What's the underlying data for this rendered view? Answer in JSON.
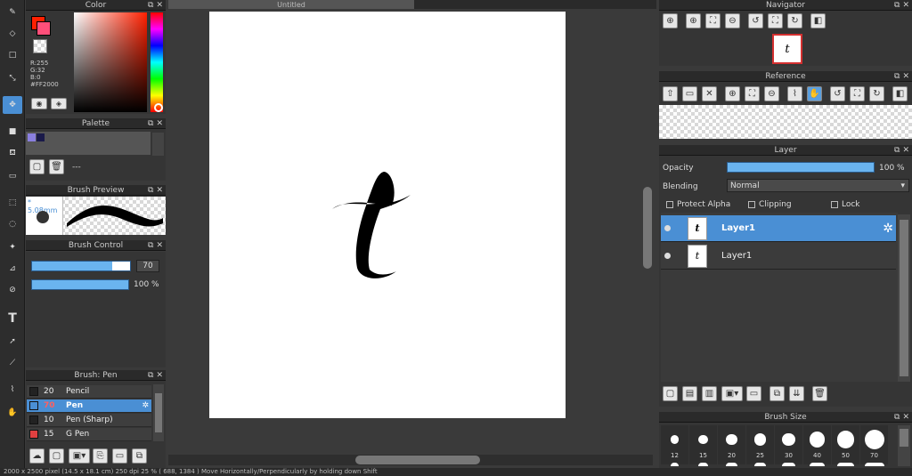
{
  "color": {
    "title": "Color",
    "r": "R:255",
    "g": "G:32",
    "b": "B:0",
    "hex": "#FF2000",
    "fg": "#FF2000",
    "bg": "#ff4f7a"
  },
  "palette": {
    "title": "Palette",
    "label": "---",
    "swatches": [
      "#8a7fe0",
      "#1a1a4a"
    ]
  },
  "brush_preview": {
    "title": "Brush Preview",
    "size": "5.08mm"
  },
  "brush_control": {
    "title": "Brush Control",
    "size_value": "70",
    "size_fraction": 0.82,
    "opacity_value": "100 %",
    "opacity_fraction": 1.0
  },
  "brush_list": {
    "title": "Brush: Pen",
    "items": [
      {
        "size": "20",
        "name": "Pencil",
        "color": "#222222",
        "selected": false
      },
      {
        "size": "70",
        "name": "Pen",
        "color": "#4a8fd4",
        "selected": true
      },
      {
        "size": "10",
        "name": "Pen (Sharp)",
        "color": "#222222",
        "selected": false
      },
      {
        "size": "15",
        "name": "G Pen",
        "color": "#e04040",
        "selected": false
      }
    ]
  },
  "canvas": {
    "tab_title": "Untitled",
    "glyph": "t"
  },
  "navigator": {
    "title": "Navigator",
    "thumb_glyph": "t"
  },
  "reference": {
    "title": "Reference"
  },
  "layer": {
    "title": "Layer",
    "opacity_label": "Opacity",
    "opacity_value": "100 %",
    "opacity_fraction": 1.0,
    "blending_label": "Blending",
    "blending_value": "Normal",
    "protect_alpha": "Protect Alpha",
    "clipping": "Clipping",
    "lock": "Lock",
    "layers": [
      {
        "name": "Layer1",
        "selected": true
      },
      {
        "name": "Layer1",
        "selected": false
      }
    ]
  },
  "brush_size": {
    "title": "Brush Size",
    "sizes": [
      "12",
      "15",
      "20",
      "25",
      "30",
      "40",
      "50",
      "70"
    ]
  },
  "status": {
    "text": "2000 x 2500 pixel   (14.5 x 18.1 cm)   250 dpi   25 %   ( 688, 1384 )   Move Horizontally/Perpendicularly by holding down Shift"
  }
}
